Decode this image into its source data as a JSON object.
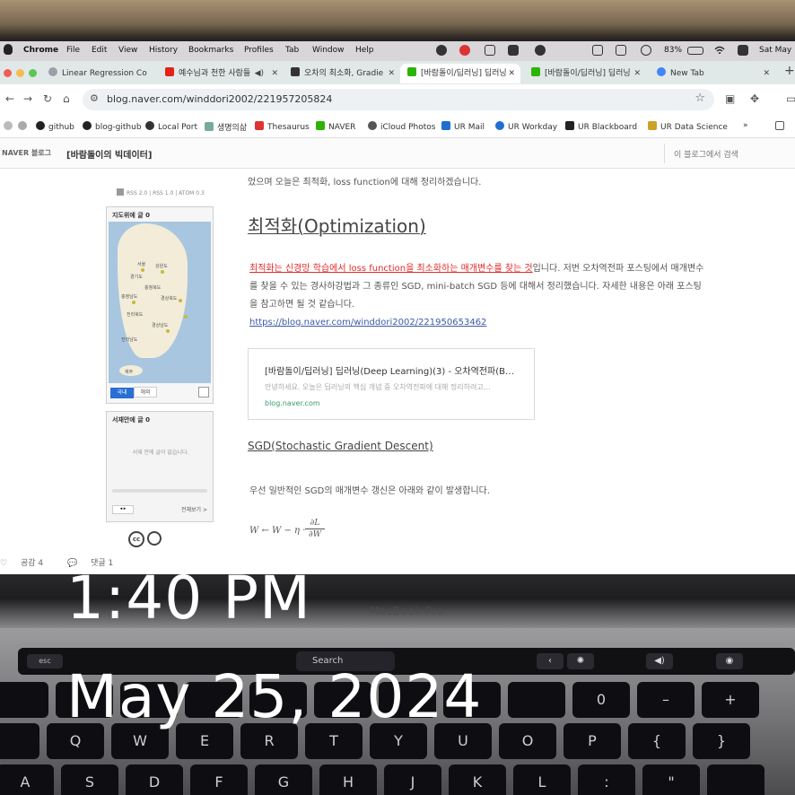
{
  "overlay": {
    "time": "1:40 PM",
    "date": "May 25, 2024"
  },
  "device": {
    "model": "MacBook Pro"
  },
  "menubar": {
    "items": [
      "Chrome",
      "File",
      "Edit",
      "View",
      "History",
      "Bookmarks",
      "Profiles",
      "Tab",
      "Window",
      "Help"
    ],
    "battery": "83%",
    "datetime": "Sat May"
  },
  "tabs": [
    {
      "title": "Linear Regression Co",
      "color": "#9aa0a6"
    },
    {
      "title": "예수님과 천한 사람들",
      "color": "#e62117"
    },
    {
      "title": "오차의 최소화, Gradie",
      "color": "#333333"
    },
    {
      "title": "[바람돌이/딥러닝] 딥러닝",
      "color": "#2db400"
    },
    {
      "title": "[바람돌이/딥러닝] 딥러닝",
      "color": "#2db400"
    },
    {
      "title": "New Tab",
      "color": "#4285f4"
    }
  ],
  "address": {
    "url": "blog.naver.com/winddori2002/221957205824"
  },
  "bookmarks": [
    "github",
    "blog-github",
    "Local Port",
    "생명의삶",
    "Thesaurus",
    "NAVER",
    "iCloud Photos",
    "UR Mail",
    "UR Workday",
    "UR Blackboard",
    "UR Data Science"
  ],
  "blog": {
    "brand": "NAVER 블로그",
    "title": "[바람돌이의 빅데이터]",
    "search_placeholder": "이 블로그에서 검색"
  },
  "sidebar": {
    "rss": "RSS 2.0  |  RSS 1.0  |  ATOM 0.3",
    "map": {
      "title": "지도위에 글 0",
      "labels": [
        "서울",
        "강원도",
        "경기도",
        "충청북도",
        "충청남도",
        "경상북도",
        "전라북도",
        "경상남도",
        "전라남도",
        "제주"
      ],
      "tab_domestic": "국내",
      "tab_abroad": "해외"
    },
    "neighbors": {
      "title": "서재안에 글 0",
      "empty": "서재 안에 글이 없습니다.",
      "all": "전체보기 >"
    }
  },
  "article": {
    "intro": "었으며 오늘은 최적화, loss function에 대해 정리하겠습니다.",
    "heading": "최적화(Optimization)",
    "para_highlight": "최적화는 신경망 학습에서 loss function을 최소화하는 매개변수를 찾는 것",
    "para_rest": "입니다. 저번 오차역전파 포스팅에서 매개변수를 찾을 수 있는 경사하강법과 그 종류인 SGD, mini-batch SGD 등에 대해서 정리했습니다. 자세한 내용은 아래 포스팅을 참고하면 될 것 같습니다.",
    "link": "https://blog.naver.com/winddori2002/221950653462",
    "card": {
      "title": "[바람돌이/딥러닝] 딥러닝(Deep Learning)(3) - 오차역전파(B…",
      "desc": "안녕하세요. 오늘은 딥러닝의 핵심 개념 중 오차역전파에 대해 정리하려고…",
      "domain": "blog.naver.com"
    },
    "subheading": "SGD(Stochastic Gradient Descent)",
    "sgd_text": "우선 일반적인 SGD의 매개변수 갱신은 아래와 같이 발생합니다.",
    "formula_lhs": "W ← W − η ·",
    "formula_num": "∂L",
    "formula_den": "∂W"
  },
  "reactions": {
    "likes": "공감 4",
    "comments": "댓글 1"
  }
}
